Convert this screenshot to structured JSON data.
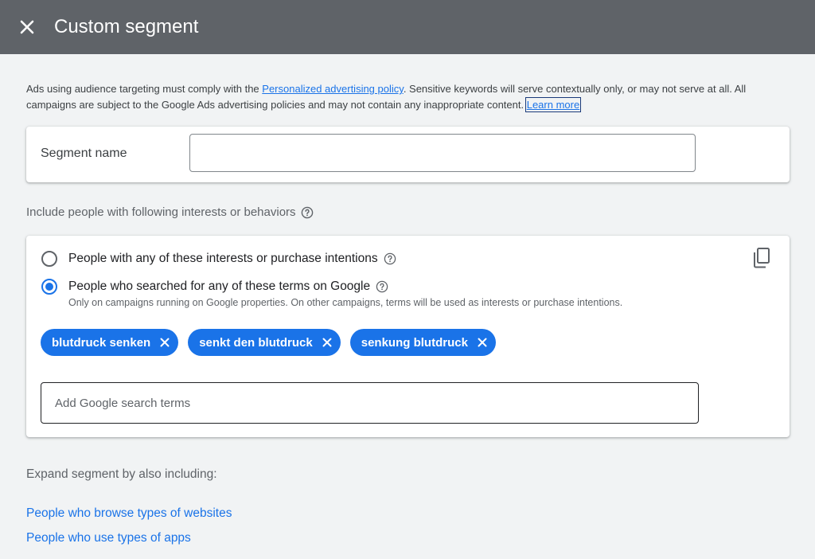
{
  "header": {
    "title": "Custom segment"
  },
  "notice": {
    "text_before": "Ads using audience targeting must comply with the ",
    "policy_link": "Personalized advertising policy",
    "text_after": ". Sensitive keywords will serve contextually only, or may not serve at all. All campaigns are subject to the Google Ads advertising policies and may not contain any inappropriate content. ",
    "learn_more": "Learn more"
  },
  "segment_name": {
    "label": "Segment name",
    "value": "",
    "placeholder": ""
  },
  "include": {
    "label": "Include people with following interests or behaviors",
    "options": [
      {
        "label": "People with any of these interests or purchase intentions",
        "selected": false
      },
      {
        "label": "People who searched for any of these terms on Google",
        "selected": true,
        "sublabel": "Only on campaigns running on Google properties. On other campaigns, terms will be used as interests or purchase intentions."
      }
    ],
    "chips": [
      "blutdruck senken",
      "senkt den blutdruck",
      "senkung blutdruck"
    ],
    "search_placeholder": "Add Google search terms"
  },
  "expand": {
    "label": "Expand segment by also including:",
    "links": [
      "People who browse types of websites",
      "People who use types of apps"
    ]
  },
  "colors": {
    "accent": "#1a73e8",
    "header_bg": "#5f6368",
    "page_bg": "#f1f3f4"
  }
}
